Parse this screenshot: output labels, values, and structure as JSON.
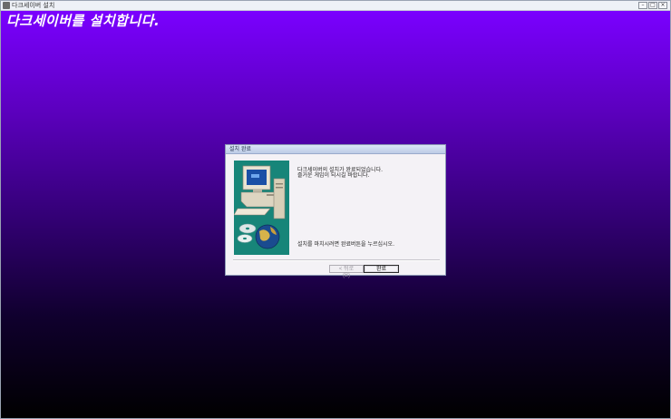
{
  "window": {
    "title": "다크세이버 설치",
    "controls": [
      "minimize",
      "maximize",
      "close"
    ]
  },
  "banner": {
    "text": "다크세이버를 설치합니다."
  },
  "dialog": {
    "title": "설치 완료",
    "message_line1": "다크세이버의 설치가 완료되었습니다.",
    "message_line2": "즐거운 게임이 되시길 바랍니다.",
    "instruction": "설치를 마치시려면 완료버튼을 누르십시오.",
    "back_label": "< 뒤로(B)",
    "finish_label": "완료",
    "illustration": "computer-globe-cd-illustration"
  },
  "colors": {
    "gradient_top": "#7a00ff",
    "gradient_bottom": "#000000",
    "illustration_bg": "#178579"
  }
}
